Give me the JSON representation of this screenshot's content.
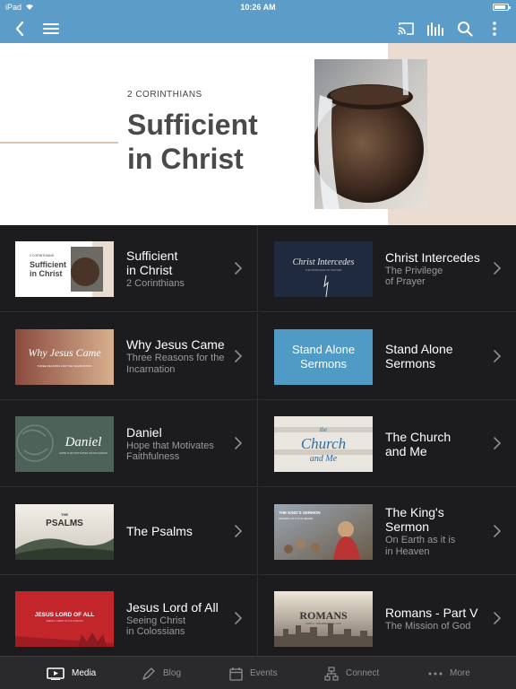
{
  "status": {
    "device": "iPad",
    "time": "10:26 AM"
  },
  "nav": {
    "icons": [
      "back-icon",
      "menu-icon",
      "cast-icon",
      "audio-icon",
      "search-icon",
      "more-icon"
    ]
  },
  "hero": {
    "eyebrow": "2 CORINTHIANS",
    "title_line1": "Sufficient",
    "title_line2": "in Christ"
  },
  "series": [
    {
      "title": "Sufficient\nin Christ",
      "subtitle": "2 Corinthians",
      "thumb": {
        "kind": "sufficient",
        "eyebrow": "2 CORINTHIANS",
        "l1": "Sufficient",
        "l2": "in Christ"
      }
    },
    {
      "title": "Christ Intercedes",
      "subtitle": "The Privilege\nof Prayer",
      "thumb": {
        "kind": "intercedes",
        "l1": "Christ Intercedes",
        "l2": "THE PRIVILEGE OF PRAYER"
      }
    },
    {
      "title": "Why Jesus Came",
      "subtitle": "Three Reasons for the\nIncarnation",
      "thumb": {
        "kind": "whyjesus",
        "l1": "Why Jesus Came",
        "l2": "THREE REASONS FOR THE INCARNATION"
      }
    },
    {
      "title": "Stand Alone\nSermons",
      "subtitle": "",
      "thumb": {
        "kind": "standalone",
        "l1": "Stand Alone",
        "l2": "Sermons"
      }
    },
    {
      "title": "Daniel",
      "subtitle": "Hope that Motivates\nFaithfulness",
      "thumb": {
        "kind": "daniel",
        "l1": "Daniel",
        "l2": "HOPE THAT MOTIVATES FAITHFULNESS"
      }
    },
    {
      "title": "The Church\nand Me",
      "subtitle": "",
      "thumb": {
        "kind": "church",
        "l1": "the",
        "l2": "Church",
        "l3": "and Me"
      }
    },
    {
      "title": "The Psalms",
      "subtitle": "",
      "thumb": {
        "kind": "psalms",
        "l0": "THE",
        "l1": "PSALMS"
      }
    },
    {
      "title": "The King's\nSermon",
      "subtitle": "On Earth as it is\nin Heaven",
      "thumb": {
        "kind": "kings",
        "l1": "THE KING'S SERMON",
        "l2": "ON EARTH AS IT IS IN HEAVEN"
      }
    },
    {
      "title": "Jesus Lord of All",
      "subtitle": "Seeing Christ\nin Colossians",
      "thumb": {
        "kind": "lordofall",
        "l1": "JESUS LORD OF ALL",
        "l2": "SEEING CHRIST IN COLOSSIANS"
      }
    },
    {
      "title": "Romans - Part V",
      "subtitle": "The Mission of God",
      "thumb": {
        "kind": "romans",
        "l1": "ROMANS",
        "l2": "PART V - THE MISSION OF GOD"
      }
    }
  ],
  "tabs": [
    {
      "label": "Media",
      "icon": "media-icon",
      "active": true
    },
    {
      "label": "Blog",
      "icon": "pen-icon",
      "active": false
    },
    {
      "label": "Events",
      "icon": "calendar-icon",
      "active": false
    },
    {
      "label": "Connect",
      "icon": "connect-icon",
      "active": false
    },
    {
      "label": "More",
      "icon": "more-dots-icon",
      "active": false
    }
  ],
  "colors": {
    "nav": "#5b9cc8",
    "background": "#1c1c1e",
    "tabbar": "#2a2a2d"
  }
}
